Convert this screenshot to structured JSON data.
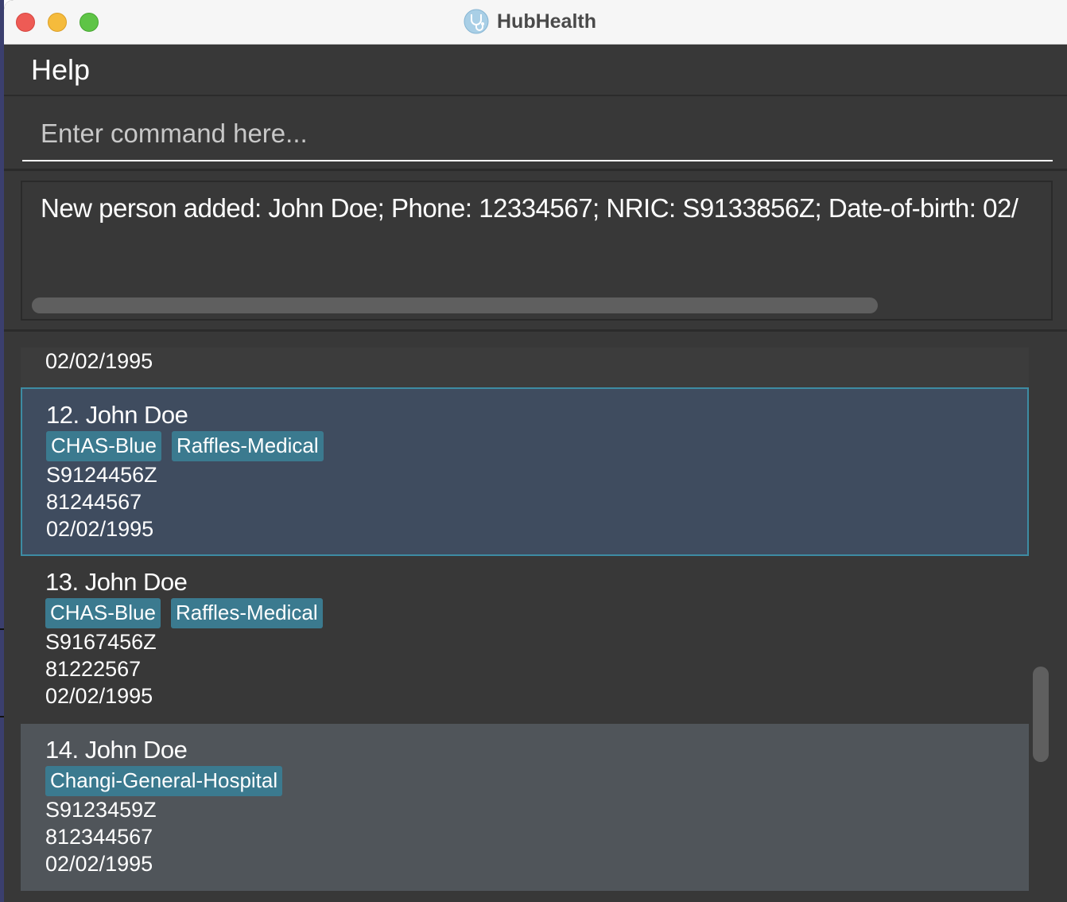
{
  "window": {
    "title": "HubHealth",
    "icon": "stethoscope-icon"
  },
  "menu": {
    "help_label": "Help"
  },
  "command": {
    "placeholder": "Enter command here...",
    "value": ""
  },
  "result": {
    "text": "New person added: John Doe; Phone: 12334567; NRIC: S9133856Z; Date-of-birth: 02/"
  },
  "persons": {
    "partial_top": {
      "dob": "02/02/1995"
    },
    "items": [
      {
        "name": "12. John Doe",
        "tags": [
          "CHAS-Blue",
          "Raffles-Medical"
        ],
        "nric": "S9124456Z",
        "phone": "81244567",
        "dob": "02/02/1995",
        "state": "selected"
      },
      {
        "name": "13. John Doe",
        "tags": [
          "CHAS-Blue",
          "Raffles-Medical"
        ],
        "nric": "S9167456Z",
        "phone": "81222567",
        "dob": "02/02/1995",
        "state": "normal"
      },
      {
        "name": "14. John Doe",
        "tags": [
          "Changi-General-Hospital"
        ],
        "nric": "S9123459Z",
        "phone": "812344567",
        "dob": "02/02/1995",
        "state": "hover"
      }
    ]
  },
  "colors": {
    "background": "#383838",
    "tag": "#3b7a8f",
    "selected_row": "#3f4c5f",
    "selected_border": "#3d8ca3",
    "hover_row": "#50555a"
  }
}
